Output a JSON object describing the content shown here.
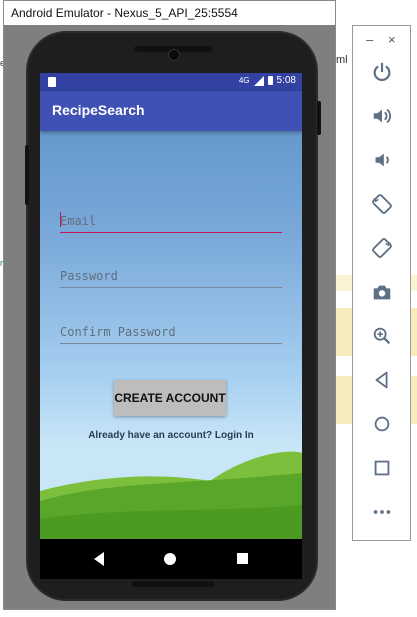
{
  "window": {
    "title": "Android Emulator - Nexus_5_API_25:5554"
  },
  "background": {
    "tab_fragment": "ml",
    "left_mark_top": "e",
    "left_mark_mid": "r"
  },
  "status_bar": {
    "network": "4G",
    "time": "5:08"
  },
  "app": {
    "title": "RecipeSearch"
  },
  "form": {
    "email": {
      "placeholder": "Email",
      "value": ""
    },
    "password": {
      "placeholder": "Password",
      "value": ""
    },
    "confirm_password": {
      "placeholder": "Confirm Password",
      "value": ""
    },
    "create_button_label": "CREATE ACCOUNT",
    "login_link": "Already have an account? Login In"
  },
  "toolbar": {
    "minimize": "–",
    "close": "×",
    "buttons": [
      "power-icon",
      "volume-up-icon",
      "volume-down-icon",
      "rotate-left-icon",
      "rotate-right-icon",
      "camera-icon",
      "zoom-icon",
      "back-icon",
      "home-icon",
      "overview-icon",
      "more-icon"
    ]
  },
  "colors": {
    "accent": "#3f51b5",
    "status_bar": "#3341a2",
    "focus_line": "#c2185b",
    "button": "#bdbdbd"
  }
}
